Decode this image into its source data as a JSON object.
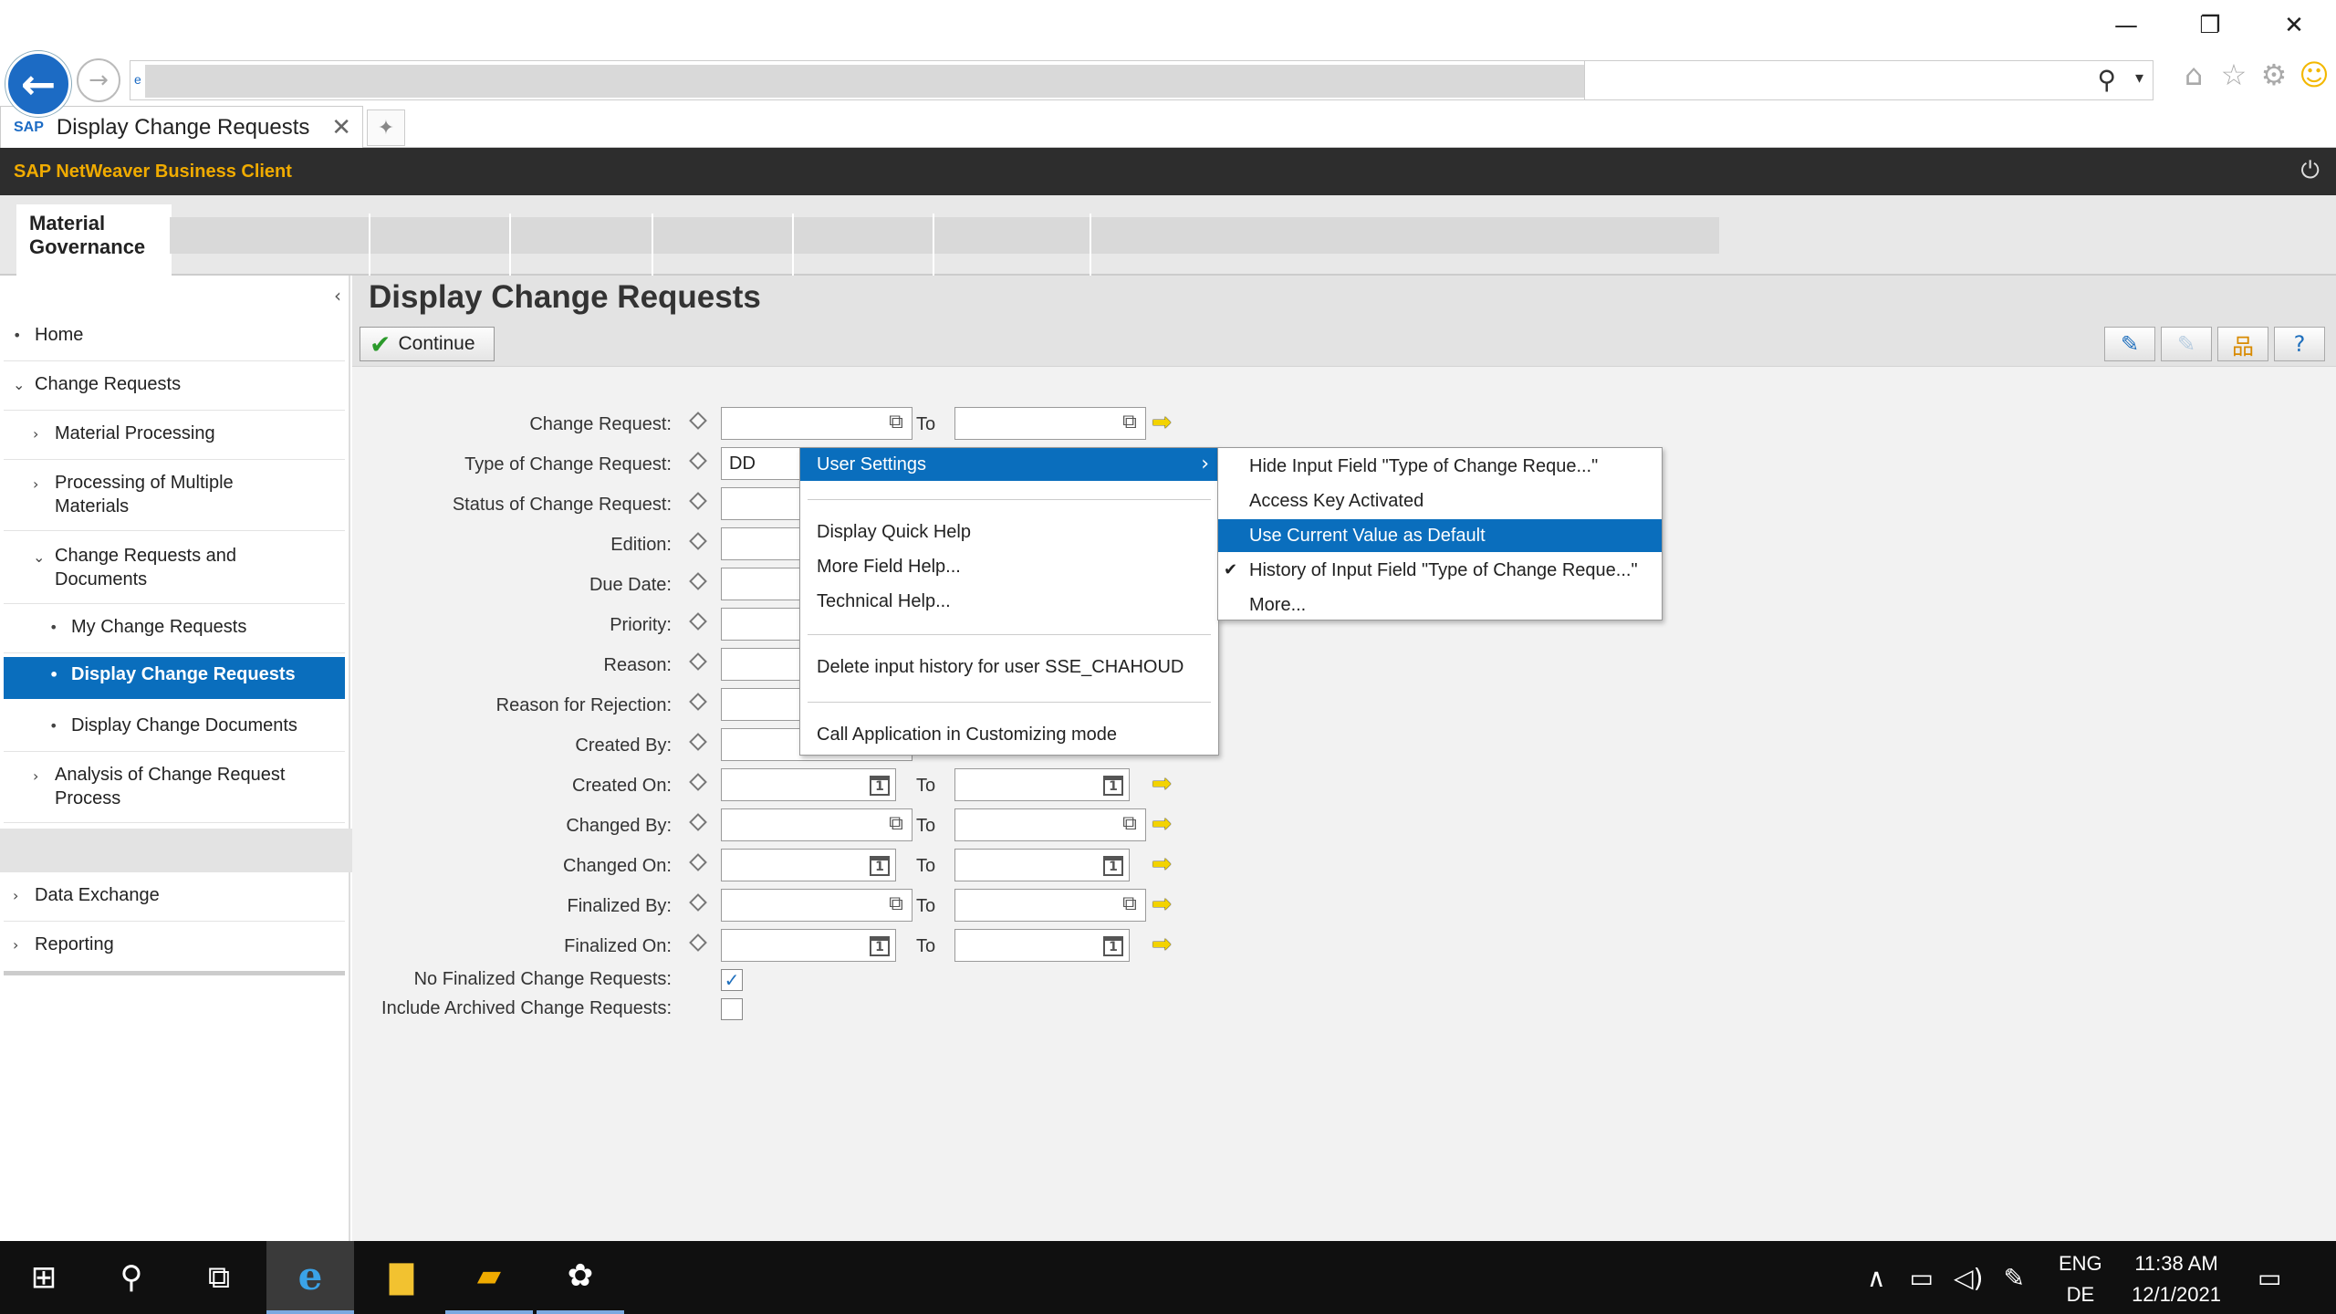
{
  "window": {
    "minimize": "—",
    "restore": "❐",
    "close": "✕"
  },
  "browser": {
    "back_glyph": "←",
    "forward_glyph": "→",
    "tab_title": "Display Change Requests",
    "tab_close": "✕",
    "search_glyph": "⚲",
    "search_drop": "▾",
    "tools": {
      "home": "⌂",
      "star": "☆",
      "gear": "⚙",
      "smile": "☺"
    }
  },
  "sap": {
    "app_title": "SAP NetWeaver Business Client",
    "power_glyph": "⏻",
    "nav_active": "Material Governance"
  },
  "sidebar": {
    "collapse_glyph": "‹",
    "items": [
      {
        "label": "Home",
        "mk": "•"
      },
      {
        "label": "Change Requests",
        "mk": "⌄"
      },
      {
        "label": "Material Processing",
        "mk": "›"
      },
      {
        "label": "Processing of Multiple Materials",
        "mk": "›"
      },
      {
        "label": "Change Requests and Documents",
        "mk": "⌄"
      },
      {
        "label": "My Change Requests",
        "mk": "•"
      },
      {
        "label": "Display Change Requests",
        "mk": "•"
      },
      {
        "label": "Display Change Documents",
        "mk": "•"
      },
      {
        "label": "Analysis of Change Request Process",
        "mk": "›"
      },
      {
        "label": "Data Exchange",
        "mk": "›"
      },
      {
        "label": "Reporting",
        "mk": "›"
      }
    ]
  },
  "page": {
    "title": "Display Change Requests",
    "continue_label": "Continue",
    "continue_glyph": "✔",
    "tools": {
      "wrench": "🔧",
      "wrench_disabled": "🔧",
      "hierarchy": "⊞",
      "help": "?"
    }
  },
  "form": {
    "to_label": "To",
    "arrow_glyph": "➡",
    "fields": [
      {
        "label": "Change Request:",
        "value": "",
        "icon": "⧉"
      },
      {
        "label": "Type of Change Request:",
        "value": "DD",
        "icon": ""
      },
      {
        "label": "Status of Change Request:",
        "value": "",
        "icon": ""
      },
      {
        "label": "Edition:",
        "value": "",
        "icon": ""
      },
      {
        "label": "Due Date:",
        "value": "",
        "icon": ""
      },
      {
        "label": "Priority:",
        "value": "",
        "icon": ""
      },
      {
        "label": "Reason:",
        "value": "",
        "icon": ""
      },
      {
        "label": "Reason for Rejection:",
        "value": "",
        "icon": ""
      },
      {
        "label": "Created By:",
        "value": "",
        "icon": ""
      },
      {
        "label": "Created On:",
        "value": "",
        "icon": "1"
      },
      {
        "label": "Changed By:",
        "value": "",
        "icon": "⧉"
      },
      {
        "label": "Changed On:",
        "value": "",
        "icon": "1"
      },
      {
        "label": "Finalized By:",
        "value": "",
        "icon": "⧉"
      },
      {
        "label": "Finalized On:",
        "value": "",
        "icon": "1"
      }
    ],
    "checkboxes": [
      {
        "label": "No Finalized Change Requests:",
        "checked": true,
        "glyph": "✓"
      },
      {
        "label": "Include Archived Change Requests:",
        "checked": false,
        "glyph": ""
      }
    ]
  },
  "context_menu": {
    "arrow": "›",
    "items": [
      "User Settings",
      "Display Quick Help",
      "More Field Help...",
      "Technical Help...",
      "Delete input history for user SSE_CHAHOUD",
      "Call Application in Customizing mode"
    ]
  },
  "submenu": {
    "check": "✔",
    "items": [
      "Hide Input Field \"Type of Change Reque...\"",
      "Access Key Activated",
      "Use Current Value as Default",
      "History of Input Field \"Type of Change Reque...\"",
      "More..."
    ]
  },
  "taskbar": {
    "start": "⊞",
    "search": "⚲",
    "taskview": "⧉",
    "ie": "e",
    "explorer": "▬",
    "app1": "▰",
    "paint": "🎨",
    "tray_up": "∧",
    "tray_net": "🖧",
    "tray_vol": "🔊",
    "tray_pen": "✎",
    "lang1": "ENG",
    "lang2": "DE",
    "time": "11:38 AM",
    "date": "12/1/2021",
    "notify": "🗨"
  }
}
